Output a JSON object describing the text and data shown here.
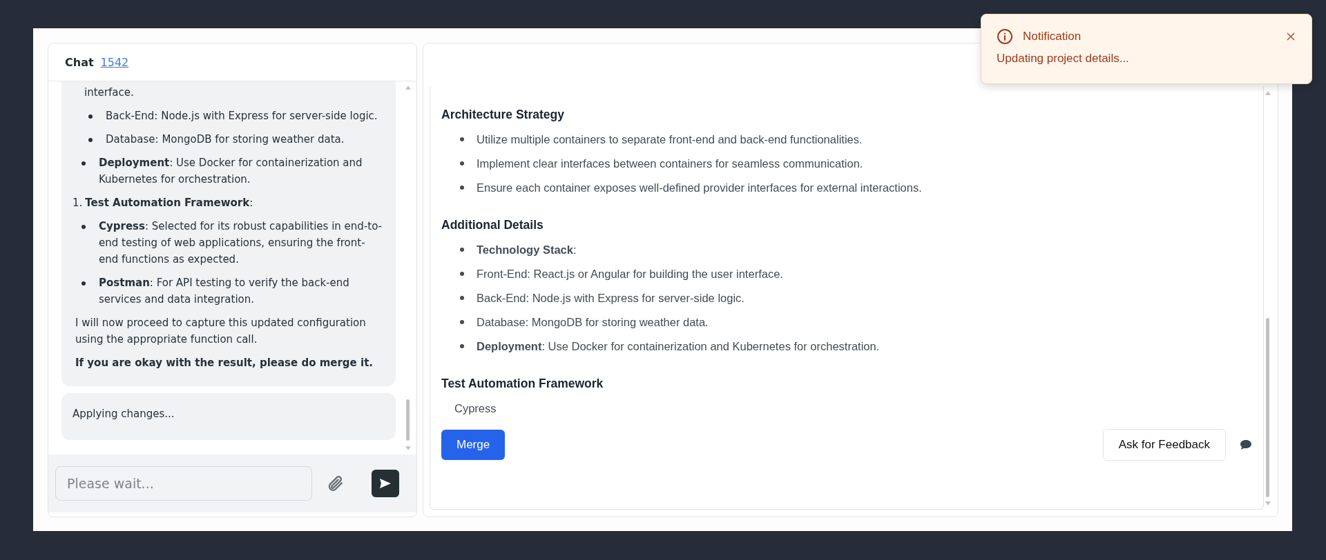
{
  "chat": {
    "title": "Chat",
    "link": "1542",
    "messages": [
      {
        "blocks": [
          {
            "kind": "continuation",
            "text": "interface."
          },
          {
            "kind": "sub-bullet",
            "text": "Back-End: Node.js with Express for server-side logic."
          },
          {
            "kind": "sub-bullet",
            "text": "Database: MongoDB for storing weather data."
          },
          {
            "kind": "bullet",
            "text": "**Deployment**: Use Docker for containerization and Kubernetes for orchestration."
          },
          {
            "kind": "numbered",
            "number": "1.",
            "text": "**Test Automation Framework**:"
          },
          {
            "kind": "bullet",
            "text": "**Cypress**: Selected for its robust capabilities in end-to-end testing of web applications, ensuring the front-end functions as expected."
          },
          {
            "kind": "bullet",
            "text": "**Postman**: For API testing to verify the back-end services and data integration."
          },
          {
            "kind": "paragraph",
            "text": "I will now proceed to capture this updated configuration using the appropriate function call."
          },
          {
            "kind": "bold-paragraph",
            "text": "If you are okay with the result, please do merge it."
          }
        ]
      },
      {
        "blocks": [
          {
            "kind": "paragraph",
            "text": "Applying changes..."
          }
        ]
      }
    ],
    "input": {
      "placeholder": "Please wait..."
    }
  },
  "details": {
    "sections": [
      {
        "heading": "Architecture Strategy",
        "items": [
          {
            "kind": "bullet",
            "text": "Utilize multiple containers to separate front-end and back-end functionalities."
          },
          {
            "kind": "bullet",
            "text": "Implement clear interfaces between containers for seamless communication."
          },
          {
            "kind": "bullet",
            "text": "Ensure each container exposes well-defined provider interfaces for external interactions."
          }
        ]
      },
      {
        "heading": "Additional Details",
        "items": [
          {
            "kind": "bullet",
            "text": "**Technology Stack**:"
          },
          {
            "kind": "bullet",
            "text": "Front-End: React.js or Angular for building the user interface."
          },
          {
            "kind": "bullet",
            "text": "Back-End: Node.js with Express for server-side logic."
          },
          {
            "kind": "bullet",
            "text": "Database: MongoDB for storing weather data."
          },
          {
            "kind": "bullet",
            "text": "**Deployment**: Use Docker for containerization and Kubernetes for orchestration."
          }
        ]
      },
      {
        "heading": "Test Automation Framework",
        "items": [
          {
            "kind": "plain",
            "text": "Cypress"
          }
        ]
      }
    ],
    "merge_button": "Merge",
    "feedback_button": "Ask for Feedback"
  },
  "notification": {
    "title": "Notification",
    "message": "Updating project details..."
  }
}
